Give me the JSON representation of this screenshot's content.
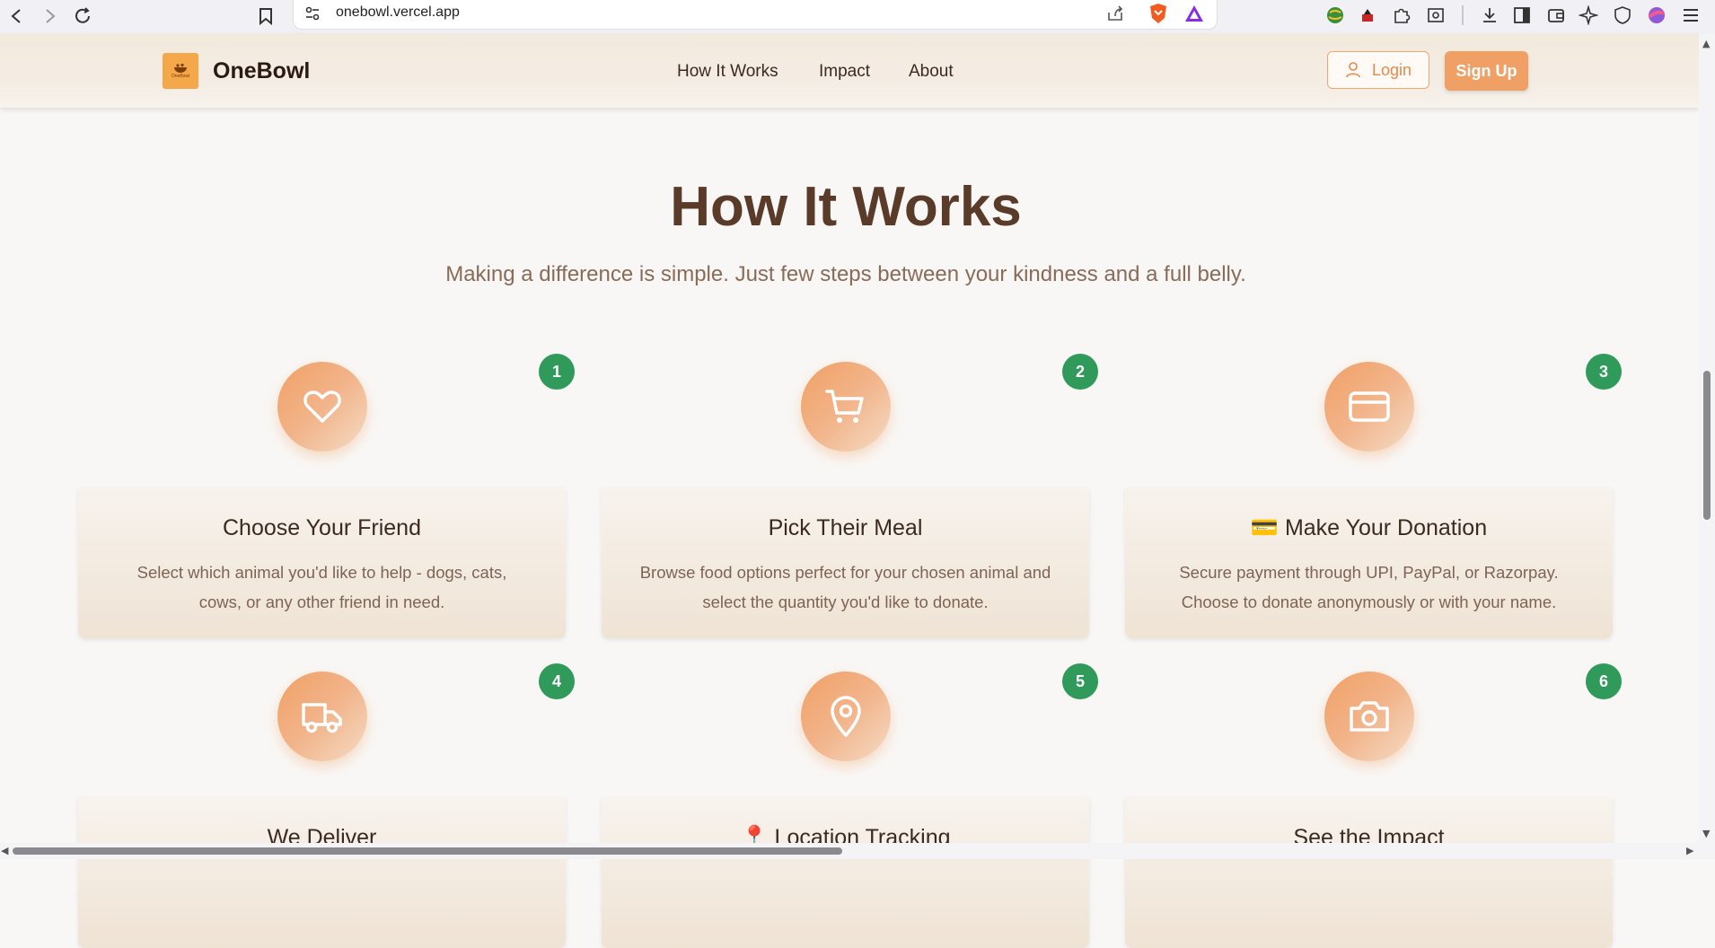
{
  "browser": {
    "url": "onebowl.vercel.app"
  },
  "header": {
    "brand": "OneBowl",
    "logo_text": "OneBowl",
    "nav": [
      "How It Works",
      "Impact",
      "About"
    ],
    "login_label": "Login",
    "signup_label": "Sign Up"
  },
  "main": {
    "title": "How It Works",
    "subtitle": "Making a difference is simple. Just few steps between your kindness and a full belly.",
    "steps": [
      {
        "number": "1",
        "icon": "heart-icon",
        "title": "Choose Your Friend",
        "description": "Select which animal you'd like to help - dogs, cats, cows, or any other friend in need."
      },
      {
        "number": "2",
        "icon": "cart-icon",
        "title": "Pick Their Meal",
        "description": "Browse food options perfect for your chosen animal and select the quantity you'd like to donate."
      },
      {
        "number": "3",
        "icon": "credit-card-icon",
        "title": "💳 Make Your Donation",
        "description": "Secure payment through UPI, PayPal, or Razorpay. Choose to donate anonymously or with your name."
      },
      {
        "number": "4",
        "icon": "truck-icon",
        "title": "We Deliver",
        "description": ""
      },
      {
        "number": "5",
        "icon": "map-pin-icon",
        "title": "📍 Location Tracking",
        "description": ""
      },
      {
        "number": "6",
        "icon": "camera-icon",
        "title": "See the Impact",
        "description": ""
      }
    ]
  },
  "colors": {
    "accent": "#f0a065",
    "badge": "#2f9a5a",
    "heading": "#5a3a28"
  }
}
